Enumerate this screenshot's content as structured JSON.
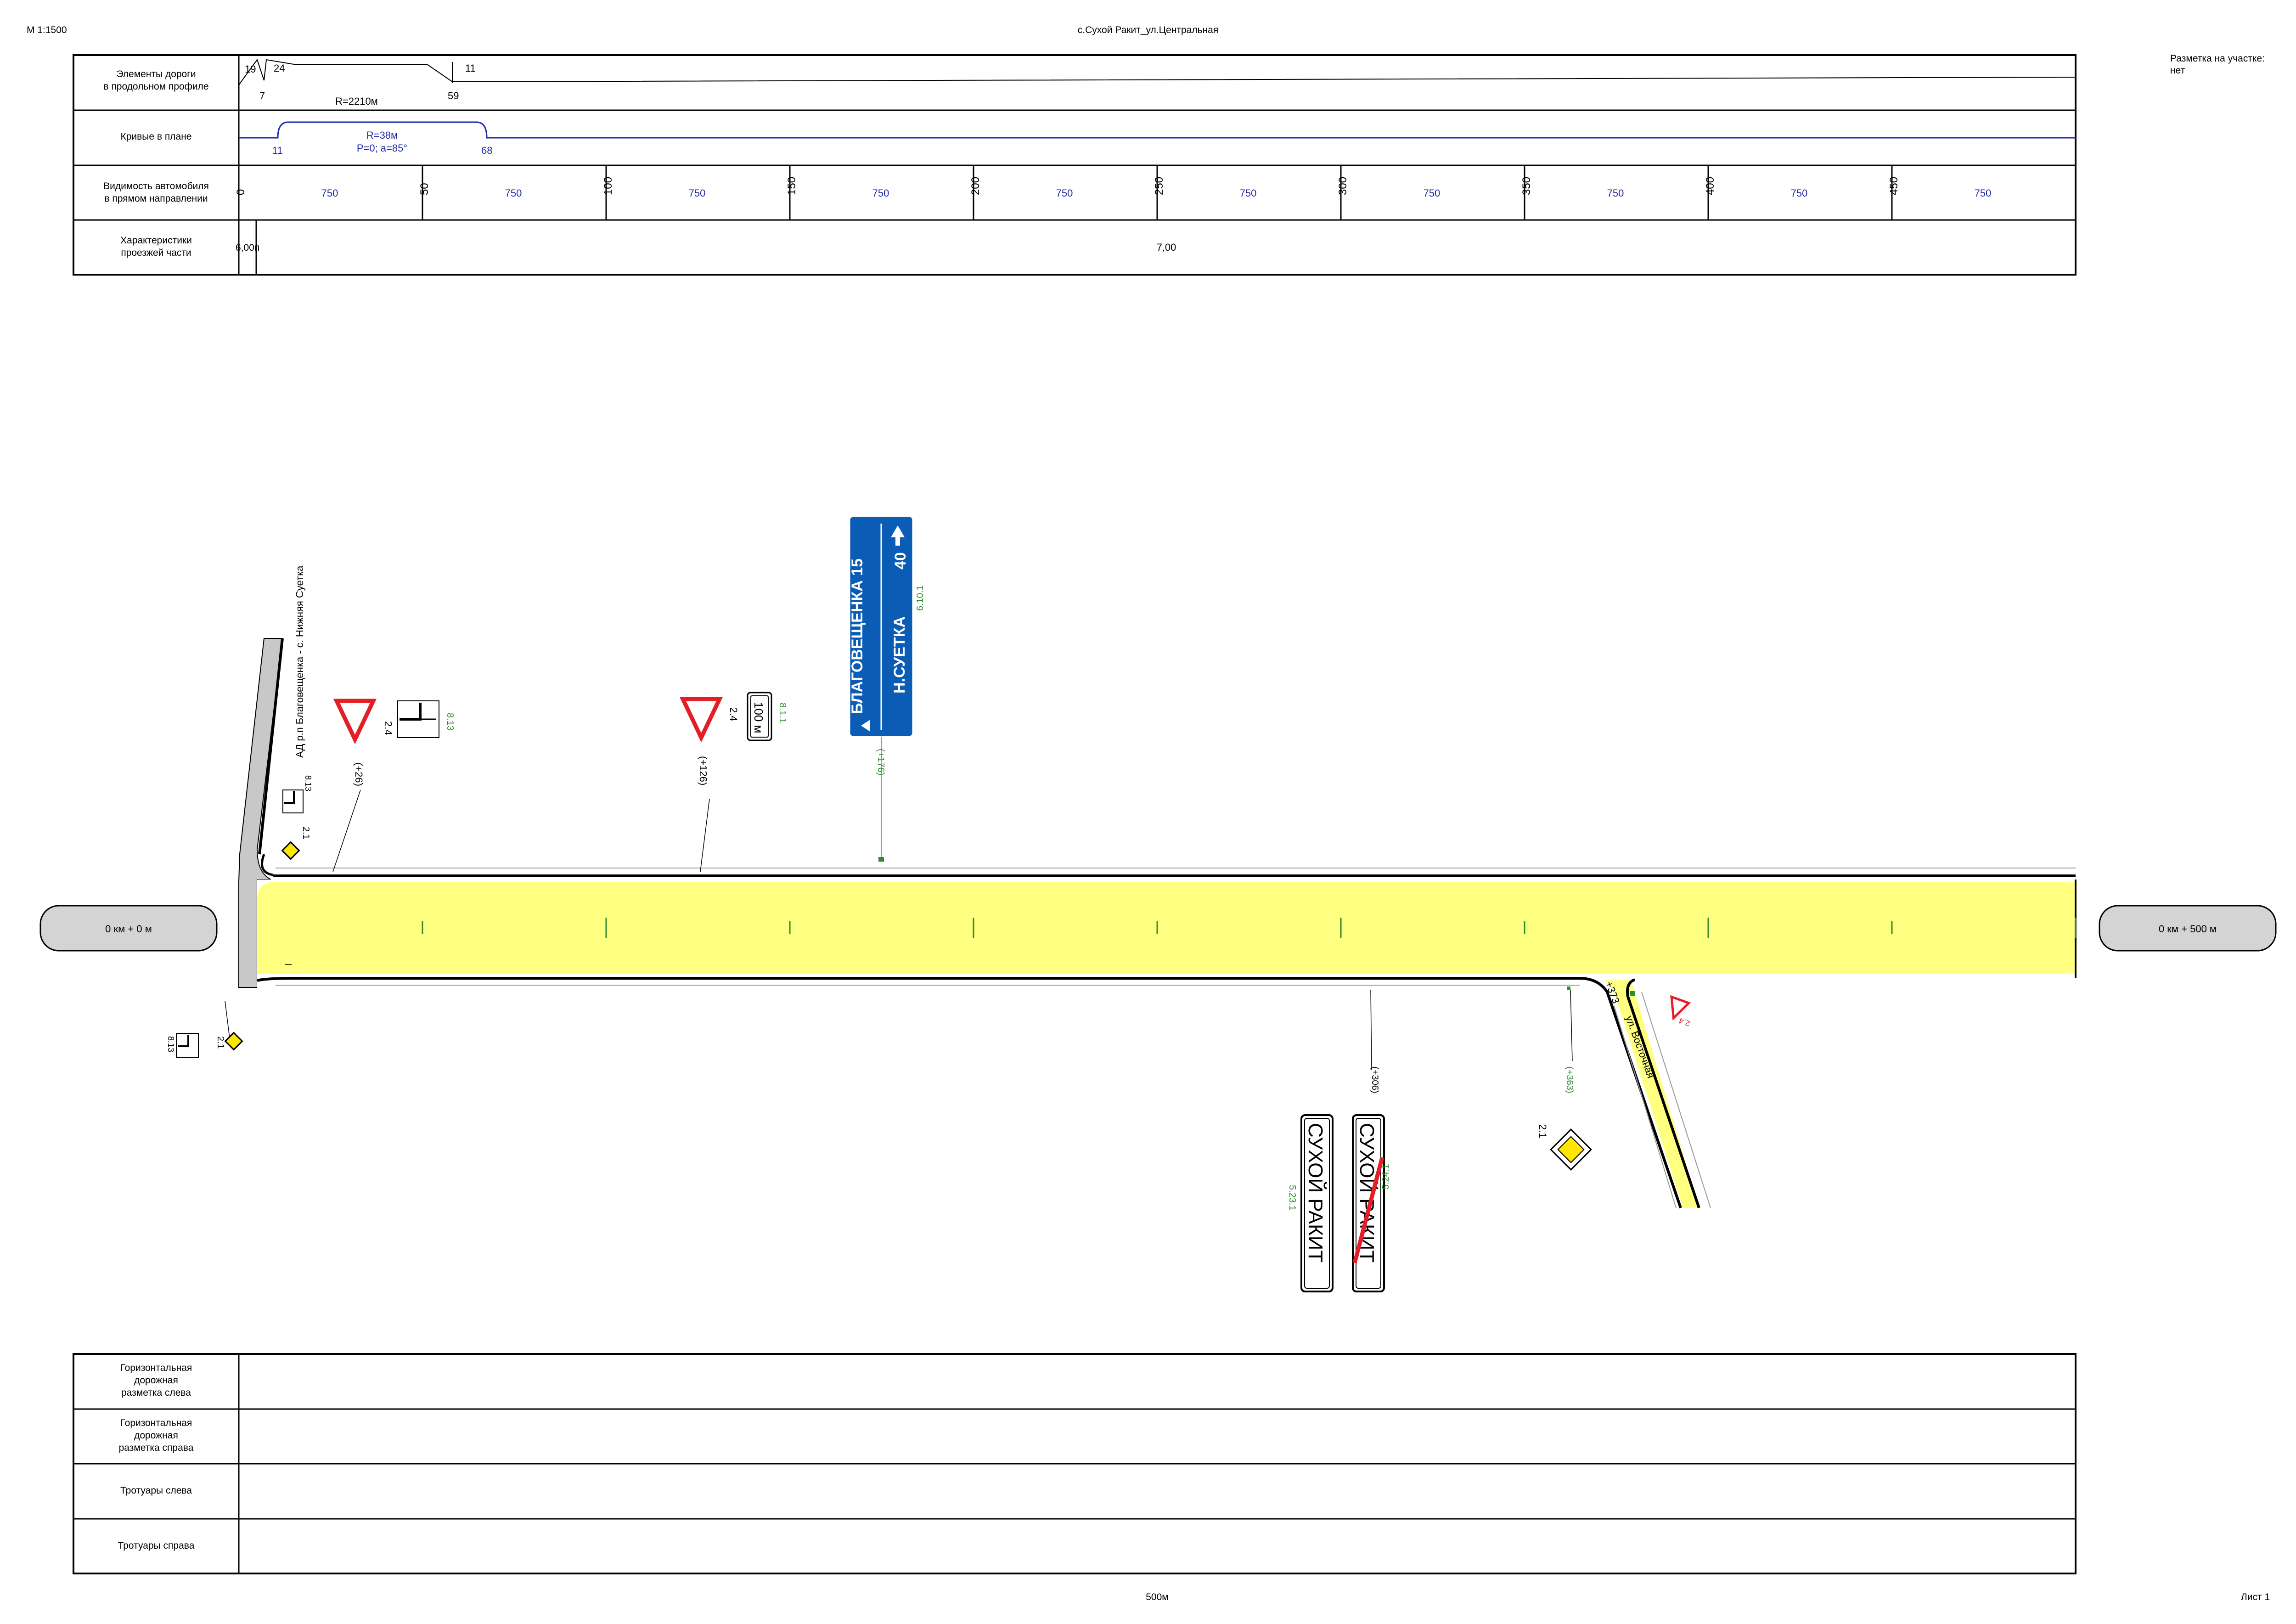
{
  "header": {
    "scale": "М 1:1500",
    "title": "с.Сухой Ракит_ул.Центральная",
    "markup_note_line1": "Разметка на участке:",
    "markup_note_line2": "нет"
  },
  "footer": {
    "length": "500м",
    "sheet": "Лист 1"
  },
  "top_table": {
    "rows": [
      {
        "label_line1": "Элементы дороги",
        "label_line2": "в продольном профиле"
      },
      {
        "label_line1": "Кривые в плане",
        "label_line2": ""
      },
      {
        "label_line1": "Видимость автомобиля",
        "label_line2": "в прямом направлении"
      },
      {
        "label_line1": "Характеристики",
        "label_line2": "проезжей части"
      }
    ],
    "profile": {
      "n19": "19",
      "n24": "24",
      "n11": "11",
      "n7": "7",
      "radius": "R=2210м",
      "n59": "59"
    },
    "plan_curve": {
      "radius": "R=38м",
      "params": "P=0; a=85°",
      "start": "11",
      "end": "68"
    },
    "visibility": {
      "pickets": [
        "0",
        "50",
        "100",
        "150",
        "200",
        "250",
        "300",
        "350",
        "400",
        "450"
      ],
      "value": "750"
    },
    "carriageway": {
      "width_start": "6,00п",
      "width_main": "7,00"
    }
  },
  "bottom_table": {
    "rows": [
      {
        "l1": "Горизонтальная",
        "l2": "дорожная",
        "l3": "разметка слева"
      },
      {
        "l1": "Горизонтальная",
        "l2": "дорожная",
        "l3": "разметка справа"
      },
      {
        "l1": "Тротуары слева",
        "l2": "",
        "l3": ""
      },
      {
        "l1": "Тротуары справа",
        "l2": "",
        "l3": ""
      }
    ]
  },
  "plan": {
    "start_label": "0 км + 0 м",
    "end_label": "0 км + 500 м",
    "side_road_left": "АД р.п Благовещенка - с. Нижняя Суетка",
    "side_road_right": "ул. Восточная",
    "junction_mark": "+373",
    "signs": {
      "s24_code": "2.4",
      "s813_code": "8.13",
      "s811_code": "8.1.1",
      "s811_text": "100 м",
      "s21_code": "2.1",
      "s6101_code": "6.10.1",
      "s6101_line1": "БЛАГОВЕЩЕНКА 15",
      "s6101_line2": "Н.СУЕТКА",
      "s6101_dist": "40",
      "s5231_code": "5.23.1",
      "s5241_code": "5.24.1",
      "town_name": "СУХОЙ РАКИТ",
      "p26": "(+26)",
      "p126": "(+126)",
      "p176": "(+176)",
      "p306": "(+306)",
      "p363": "(+363)"
    }
  },
  "colors": {
    "road": "#ffff80",
    "sign_blue": "#0a5cb5",
    "sign_red": "#e41e26",
    "label_blue": "#1f2aa8",
    "code_green": "#2e8b2e"
  }
}
